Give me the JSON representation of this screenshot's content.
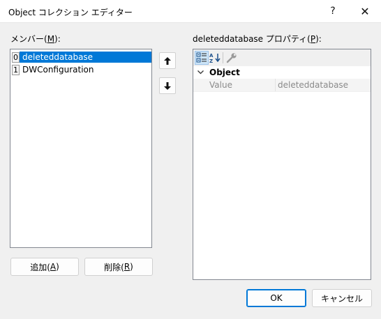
{
  "window": {
    "title": "Object コレクション エディター",
    "help_icon": "?",
    "close_icon": "✕"
  },
  "members": {
    "label": "メンバー(",
    "label_key": "M",
    "label_end": "):",
    "items": [
      {
        "index": "0",
        "name": "deleteddatabase",
        "selected": true
      },
      {
        "index": "1",
        "name": "DWConfiguration",
        "selected": false
      }
    ],
    "move_up_icon": "arrow-up-icon",
    "move_down_icon": "arrow-down-icon",
    "add_label": "追加(",
    "add_key": "A",
    "add_end": ")",
    "remove_label": "削除(",
    "remove_key": "R",
    "remove_end": ")"
  },
  "properties": {
    "label": "deleteddatabase プロパティ(",
    "label_key": "P",
    "label_end": "):",
    "toolbar": [
      "categorized-icon",
      "alphabetical-icon",
      "property-pages-icon"
    ],
    "category": "Object",
    "rows": [
      {
        "name": "Value",
        "value": "deleteddatabase"
      }
    ]
  },
  "footer": {
    "ok_label": "OK",
    "cancel_label": "キャンセル"
  },
  "colors": {
    "selection": "#0078d7",
    "background": "#f0f0f0"
  }
}
